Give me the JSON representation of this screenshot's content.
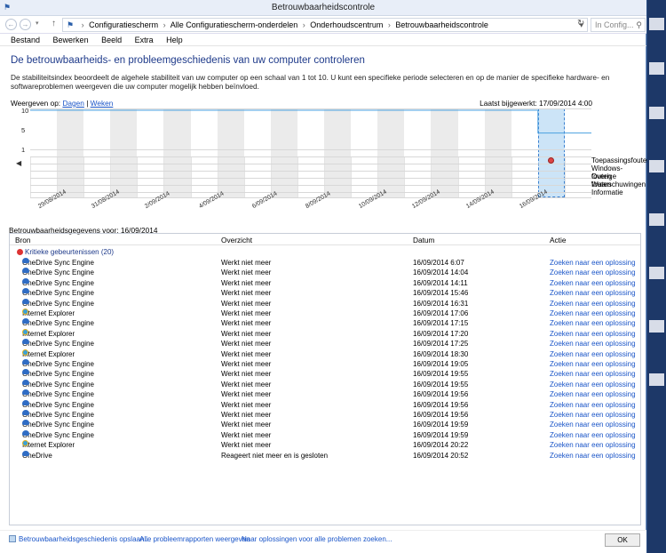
{
  "window": {
    "title": "Betrouwbaarheidscontrole"
  },
  "address": {
    "crumbs": [
      "Configuratiescherm",
      "Alle Configuratiescherm-onderdelen",
      "Onderhoudscentrum",
      "Betrouwbaarheidscontrole"
    ],
    "search_placeholder": "In Config..."
  },
  "menu": [
    "Bestand",
    "Bewerken",
    "Beeld",
    "Extra",
    "Help"
  ],
  "main": {
    "heading": "De betrouwbaarheids- en probleemgeschiedenis van uw computer controleren",
    "description": "De stabiliteitsindex beoordeelt de algehele stabiliteit van uw computer op een schaal van 1 tot 10. U kunt een specifieke periode selecteren en op de manier de specifieke hardware- en softwareproblemen weergeven die uw computer mogelijk hebben beïnvloed.",
    "view_by_label": "Weergeven op:",
    "view_days": "Dagen",
    "view_weeks": "Weken",
    "last_updated": "Laatst bijgewerkt: 17/09/2014 4:00"
  },
  "chart_data": {
    "type": "line",
    "yticks": [
      "10",
      "5",
      "1"
    ],
    "ylim": [
      1,
      10
    ],
    "x_labels": [
      "29/08/2014",
      "31/08/2014",
      "2/09/2014",
      "4/09/2014",
      "6/09/2014",
      "8/09/2014",
      "10/09/2014",
      "12/09/2014",
      "14/09/2014",
      "16/09/2014"
    ],
    "categories": [
      "Toepassingsfouten",
      "Windows-fouten",
      "Overige fouten",
      "Waarschuwingen",
      "Informatie"
    ],
    "stability": [
      10,
      10,
      10,
      10,
      10,
      10,
      10,
      10,
      10,
      10,
      10,
      10,
      10,
      10,
      10,
      10,
      10,
      10,
      10,
      4.5,
      4.5
    ],
    "selected_day": "16/09/2014",
    "errors": [
      {
        "day": "16/09/2014",
        "category": "Toepassingsfouten"
      }
    ]
  },
  "details": {
    "label": "Betrouwbaarheidsgegevens voor: 16/09/2014",
    "columns": {
      "source": "Bron",
      "summary": "Overzicht",
      "date": "Datum",
      "action": "Actie"
    },
    "group_label": "Kritieke gebeurtenissen (20)",
    "rows": [
      {
        "source": "OneDrive Sync Engine",
        "icon": "onedrive-icon",
        "summary": "Werkt niet meer",
        "date": "16/09/2014 6:07",
        "action": "Zoeken naar een oplossing"
      },
      {
        "source": "OneDrive Sync Engine",
        "icon": "onedrive-icon",
        "summary": "Werkt niet meer",
        "date": "16/09/2014 14:04",
        "action": "Zoeken naar een oplossing"
      },
      {
        "source": "OneDrive Sync Engine",
        "icon": "onedrive-icon",
        "summary": "Werkt niet meer",
        "date": "16/09/2014 14:11",
        "action": "Zoeken naar een oplossing"
      },
      {
        "source": "OneDrive Sync Engine",
        "icon": "onedrive-icon",
        "summary": "Werkt niet meer",
        "date": "16/09/2014 15:46",
        "action": "Zoeken naar een oplossing"
      },
      {
        "source": "OneDrive Sync Engine",
        "icon": "onedrive-icon",
        "summary": "Werkt niet meer",
        "date": "16/09/2014 16:31",
        "action": "Zoeken naar een oplossing"
      },
      {
        "source": "Internet Explorer",
        "icon": "ie-icon",
        "summary": "Werkt niet meer",
        "date": "16/09/2014 17:06",
        "action": "Zoeken naar een oplossing"
      },
      {
        "source": "OneDrive Sync Engine",
        "icon": "onedrive-icon",
        "summary": "Werkt niet meer",
        "date": "16/09/2014 17:15",
        "action": "Zoeken naar een oplossing"
      },
      {
        "source": "Internet Explorer",
        "icon": "ie-icon",
        "summary": "Werkt niet meer",
        "date": "16/09/2014 17:20",
        "action": "Zoeken naar een oplossing"
      },
      {
        "source": "OneDrive Sync Engine",
        "icon": "onedrive-icon",
        "summary": "Werkt niet meer",
        "date": "16/09/2014 17:25",
        "action": "Zoeken naar een oplossing"
      },
      {
        "source": "Internet Explorer",
        "icon": "ie-icon",
        "summary": "Werkt niet meer",
        "date": "16/09/2014 18:30",
        "action": "Zoeken naar een oplossing"
      },
      {
        "source": "OneDrive Sync Engine",
        "icon": "onedrive-icon",
        "summary": "Werkt niet meer",
        "date": "16/09/2014 19:05",
        "action": "Zoeken naar een oplossing"
      },
      {
        "source": "OneDrive Sync Engine",
        "icon": "onedrive-icon",
        "summary": "Werkt niet meer",
        "date": "16/09/2014 19:55",
        "action": "Zoeken naar een oplossing"
      },
      {
        "source": "OneDrive Sync Engine",
        "icon": "onedrive-icon",
        "summary": "Werkt niet meer",
        "date": "16/09/2014 19:55",
        "action": "Zoeken naar een oplossing"
      },
      {
        "source": "OneDrive Sync Engine",
        "icon": "onedrive-icon",
        "summary": "Werkt niet meer",
        "date": "16/09/2014 19:56",
        "action": "Zoeken naar een oplossing"
      },
      {
        "source": "OneDrive Sync Engine",
        "icon": "onedrive-icon",
        "summary": "Werkt niet meer",
        "date": "16/09/2014 19:56",
        "action": "Zoeken naar een oplossing"
      },
      {
        "source": "OneDrive Sync Engine",
        "icon": "onedrive-icon",
        "summary": "Werkt niet meer",
        "date": "16/09/2014 19:56",
        "action": "Zoeken naar een oplossing"
      },
      {
        "source": "OneDrive Sync Engine",
        "icon": "onedrive-icon",
        "summary": "Werkt niet meer",
        "date": "16/09/2014 19:59",
        "action": "Zoeken naar een oplossing"
      },
      {
        "source": "OneDrive Sync Engine",
        "icon": "onedrive-icon",
        "summary": "Werkt niet meer",
        "date": "16/09/2014 19:59",
        "action": "Zoeken naar een oplossing"
      },
      {
        "source": "Internet Explorer",
        "icon": "ie-icon",
        "summary": "Werkt niet meer",
        "date": "16/09/2014 20:22",
        "action": "Zoeken naar een oplossing"
      },
      {
        "source": "OneDrive",
        "icon": "onedrive-icon",
        "summary": "Reageert niet meer en is gesloten",
        "date": "16/09/2014 20:52",
        "action": "Zoeken naar een oplossing"
      }
    ]
  },
  "footer": {
    "save_history": "Betrouwbaarheidsgeschiedenis opslaan...",
    "view_all": "Alle probleemrapporten weergeven",
    "check_solutions": "Naar oplossingen voor alle problemen zoeken...",
    "ok": "OK"
  }
}
